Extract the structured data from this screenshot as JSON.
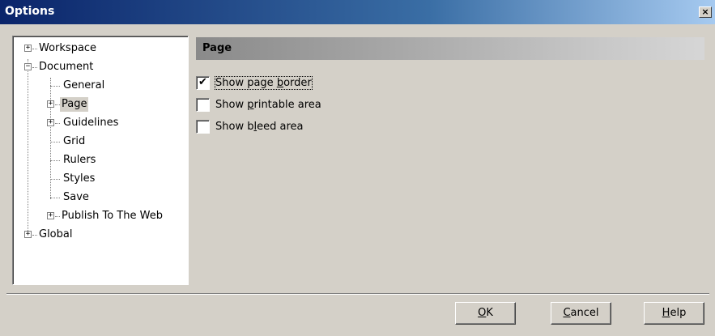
{
  "window": {
    "title": "Options",
    "close_glyph": "×"
  },
  "tree": {
    "items": [
      {
        "label": "Workspace",
        "expander": "+"
      },
      {
        "label": "Document",
        "expander": "−"
      },
      {
        "label": "General"
      },
      {
        "label": "Page",
        "expander": "+",
        "selected": true
      },
      {
        "label": "Guidelines",
        "expander": "+"
      },
      {
        "label": "Grid"
      },
      {
        "label": "Rulers"
      },
      {
        "label": "Styles"
      },
      {
        "label": "Save"
      },
      {
        "label": "Publish To The Web",
        "expander": "+"
      },
      {
        "label": "Global",
        "expander": "+"
      }
    ]
  },
  "panel": {
    "header": "Page",
    "options": [
      {
        "pre": "Show page ",
        "key": "b",
        "post": "order",
        "checked": true,
        "check_glyph": "✔"
      },
      {
        "pre": "Show ",
        "key": "p",
        "post": "rintable area",
        "checked": false
      },
      {
        "pre": "Show b",
        "key": "l",
        "post": "eed area",
        "checked": false
      }
    ]
  },
  "buttons": {
    "ok": {
      "key": "O",
      "rest": "K"
    },
    "cancel": {
      "key": "C",
      "rest": "ancel"
    },
    "help": {
      "key": "H",
      "rest": "elp"
    }
  },
  "colors": {
    "titlebar_start": "#0a246a",
    "titlebar_end": "#a6caf0",
    "face": "#d4d0c8"
  }
}
